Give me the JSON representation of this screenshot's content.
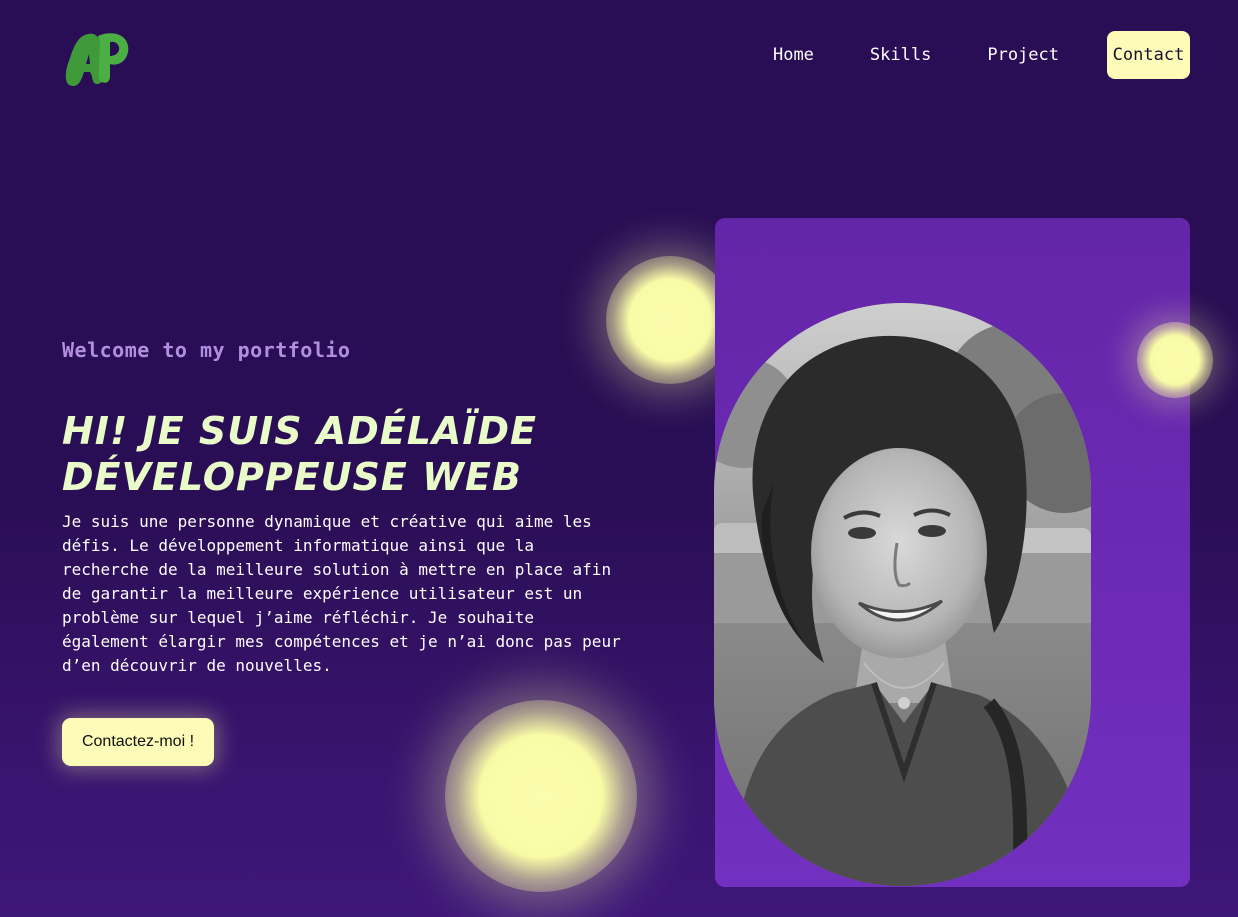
{
  "header": {
    "logo_text": "AP",
    "nav": {
      "home": "Home",
      "skills": "Skills",
      "project": "Project",
      "contact": "Contact"
    }
  },
  "hero": {
    "eyebrow": "Welcome to my portfolio",
    "headline_line1": "Hi! Je suis Adélaïde",
    "headline_line2": "développeuse web",
    "intro": "Je suis une personne dynamique et créative qui aime les défis. Le développement informatique ainsi que la recherche de la meilleure solution à mettre en place afin de garantir la meilleure expérience utilisateur est un problème sur lequel j’aime réfléchir. Je souhaite également élargir mes compétences et je n’ai donc pas peur d’en découvrir de nouvelles.",
    "cta": "Contactez-moi !"
  },
  "colors": {
    "background": "#2a0e55",
    "card": "#6c2ab6",
    "accent": "#fcfcb8",
    "headline": "#e9fbc8",
    "eyebrow": "#b28ee0",
    "logo": "#3f9a3a"
  },
  "icons": {
    "logo": "ap-logo",
    "portrait": "portrait-photo"
  }
}
